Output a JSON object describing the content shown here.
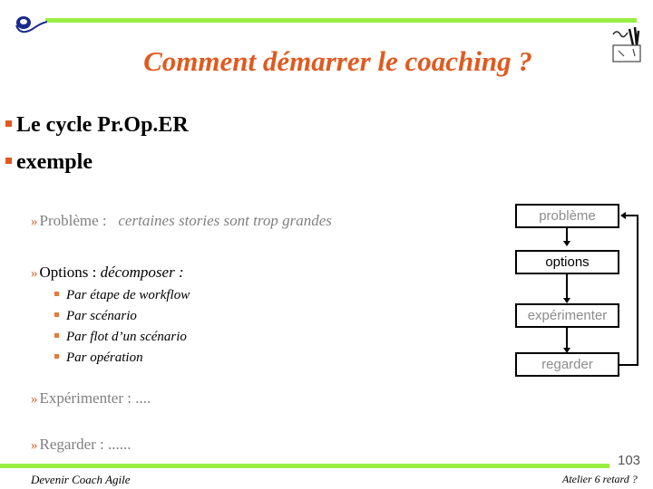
{
  "slide": {
    "title": "Comment démarrer le coaching ?",
    "page_number": "103",
    "accent_color": "#e05a1f",
    "bar_color": "#99ee44"
  },
  "bullets": [
    {
      "text": "Le cycle Pr.Op.ER"
    },
    {
      "text": "exemple"
    }
  ],
  "items": {
    "probleme": {
      "label": "Problème :",
      "value": "certaines stories sont trop grandes"
    },
    "options": {
      "label": "Options :",
      "value": "décomposer :"
    },
    "sub_options": [
      "Par étape de workflow",
      "Par scénario",
      "Par flot d’un scénario",
      "Par opération"
    ],
    "experimenter": {
      "label": "Expérimenter : ...."
    },
    "regarder": {
      "label": "Regarder : ......"
    }
  },
  "diagram": {
    "boxes": [
      "problème",
      "options",
      "expérimenter",
      "regarder"
    ]
  },
  "footer": {
    "left": "Devenir Coach Agile",
    "right": "Atelier 6 retard ?"
  },
  "icons": {
    "logo": "e-logo-icon",
    "clipart": "toolbox-clipart-icon"
  }
}
